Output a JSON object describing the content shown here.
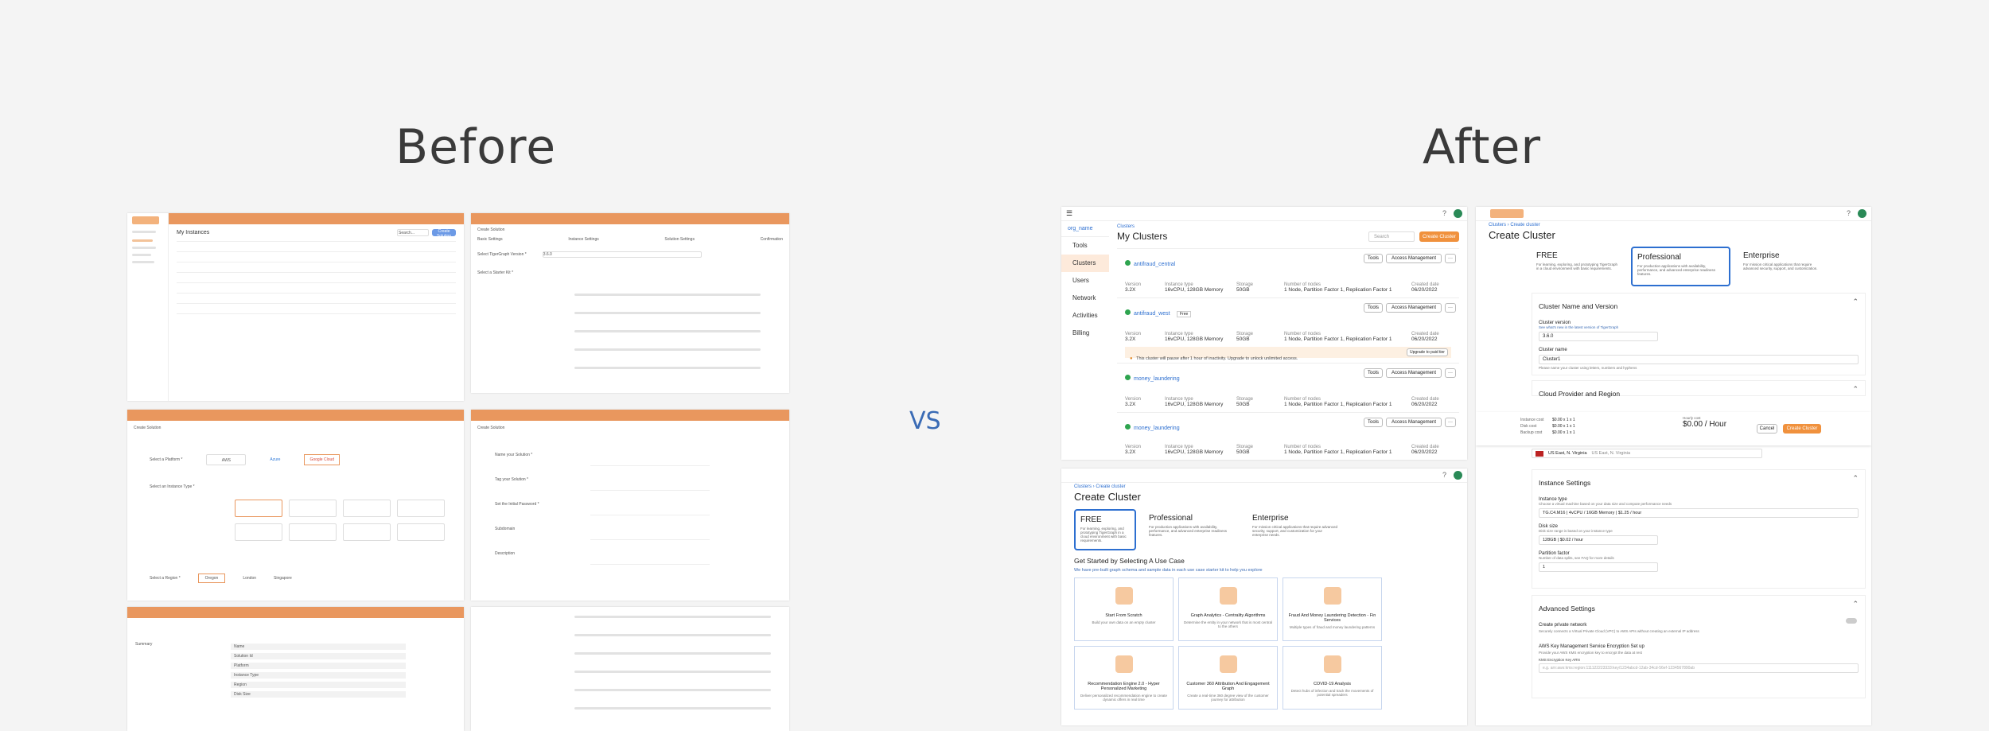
{
  "heading_before": "Before",
  "heading_after": "After",
  "vs_label": "VS",
  "brand": {
    "orange": "#e9975e",
    "accent": "#f0913d",
    "blue": "#2d6fd0",
    "vs_color": "#3a6bb5"
  },
  "before": {
    "shot1": {
      "title": "My Instances",
      "search_placeholder": "Search...",
      "new_btn": "Create Solution"
    },
    "shot2": {
      "title": "Create Solution",
      "steps": [
        "Basic Settings",
        "Instance Settings",
        "Solution Settings",
        "Confirmation"
      ],
      "version_label": "Select TigerGraph Version *",
      "version_value": "3.6.0",
      "starter_label": "Select a Starter Kit *"
    },
    "shot3": {
      "title": "Create Solution",
      "platform_label": "Select a Platform *",
      "platforms": [
        "AWS",
        "Azure",
        "Google Cloud"
      ],
      "instance_label": "Select an Instance Type *",
      "region_label": "Select a Region *",
      "regions": [
        "Oregon",
        "London",
        "Singapore"
      ]
    },
    "shot4": {
      "title": "Create Solution",
      "fields": [
        "Name your Solution *",
        "Tag your Solution *",
        "Set the Initial Password *",
        "Subdomain",
        "Description"
      ]
    },
    "shot5": {
      "title": "Summary",
      "rows": [
        "Name",
        "Solution Id",
        "Platform",
        "Instance Type",
        "Region",
        "Disk Size"
      ]
    }
  },
  "after": {
    "clusters": {
      "org_name": "org_name",
      "crumb": "Clusters",
      "title": "My Clusters",
      "search_placeholder": "Search",
      "create_btn": "Create Cluster",
      "nav": [
        "Tools",
        "Clusters",
        "Users",
        "Network",
        "Activities",
        "Billing"
      ],
      "tools_btn": "Tools",
      "access_btn": "Access Management",
      "col_headers": [
        "Version",
        "Instance type",
        "Storage",
        "Number of nodes",
        "Created date"
      ],
      "items": [
        {
          "name": "antifraud_central",
          "tag": "",
          "version": "3.2X",
          "instance": "16vCPU, 128GB Memory",
          "storage": "50GB",
          "nodes": "1 Node, Partition Factor 1, Replication Factor 1",
          "date": "06/20/2022"
        },
        {
          "name": "antifraud_west",
          "tag": "Free",
          "version": "3.2X",
          "instance": "16vCPU, 128GB Memory",
          "storage": "50GB",
          "nodes": "1 Node, Partition Factor 1, Replication Factor 1",
          "date": "06/20/2022"
        },
        {
          "name": "money_laundering",
          "tag": "",
          "version": "3.2X",
          "instance": "16vCPU, 128GB Memory",
          "storage": "50GB",
          "nodes": "1 Node, Partition Factor 1, Replication Factor 1",
          "date": "06/20/2022"
        },
        {
          "name": "money_laundering",
          "tag": "",
          "version": "3.2X",
          "instance": "16vCPU, 128GB Memory",
          "storage": "50GB",
          "nodes": "1 Node, Partition Factor 1, Replication Factor 1",
          "date": "06/20/2022"
        }
      ],
      "warning": "This cluster will pause after 1 hour of inactivity. Upgrade to unlock unlimited access.",
      "upgrade_btn": "Upgrade to paid tier"
    },
    "create": {
      "crumb": "Clusters  ›  Create cluster",
      "title": "Create Cluster",
      "tiers": [
        {
          "name": "FREE",
          "desc": "For learning, exploring, and prototyping TigerGraph in a cloud environment with basic requirements."
        },
        {
          "name": "Professional",
          "desc": "For production applications with availability, performance, and advanced enterprise readiness features."
        },
        {
          "name": "Enterprise",
          "desc": "For mission critical applications that require advanced security, support, and customization for your enterprise needs."
        }
      ],
      "usecase_title": "Get Started by Selecting A Use Case",
      "usecase_sub": "We have pre-built graph schema and sample data in each use case starter kit to help you explore",
      "cards": [
        {
          "title": "Start From Scratch",
          "sub": "Build your own data on an empty cluster"
        },
        {
          "title": "Graph Analytics - Centrality Algorithms",
          "sub": "Determine the entity in your network that is most central to the others"
        },
        {
          "title": "Fraud And Money Laundering Detection - Fin Services",
          "sub": "Multiple types of fraud and money laundering patterns"
        },
        {
          "title": "Recommendation Engine 2.0 - Hyper Personalized Marketing",
          "sub": "Deliver personalized recommendation engine to create dynamic offers in real time"
        },
        {
          "title": "Customer 360 Attribution And Engagement Graph",
          "sub": "Create a real-time 360 degree view of the customer journey for attribution"
        },
        {
          "title": "COVID-19 Analysis",
          "sub": "Detect hubs of infection and track the movements of potential spreaders"
        }
      ]
    },
    "form": {
      "crumb": "Clusters  ›  Create cluster",
      "title": "Create Cluster",
      "tiers": [
        "FREE",
        "Professional",
        "Enterprise"
      ],
      "tier_descs": [
        "For learning, exploring, and prototyping TigerGraph in a cloud environment with basic requirements.",
        "For production applications with availability, performance, and advanced enterprise readiness features.",
        "For mission critical applications that require advanced security, support, and customization."
      ],
      "sec_name": "Cluster Name and Version",
      "version_label": "Cluster version",
      "version_hint": "See what's new in the latest version of TigerGraph",
      "version_value": "3.6.0",
      "name_label": "Cluster name",
      "name_value": "Cluster1",
      "name_hint": "Please name your cluster using letters, numbers and hyphens",
      "sec_cloud": "Cloud Provider and Region",
      "cost_rows": [
        {
          "k": "Instance cost",
          "v": "$0.00 x 1 x 1"
        },
        {
          "k": "Disk cost",
          "v": "$0.00 x 1 x 1"
        },
        {
          "k": "Backup cost",
          "v": "$0.00 x 1 x 1"
        }
      ],
      "hourly_label": "Hourly cost",
      "hourly_value": "$0.00 / Hour",
      "cancel_btn": "Cancel",
      "create_btn": "Create Cluster",
      "region_value": "US East, N. Virginia",
      "region_sub": "US East, N. Virginia",
      "sec_instance": "Instance Settings",
      "itype_label": "Instance type",
      "itype_hint": "Choose a virtual machine based on your data size and compute performance needs",
      "itype_value": "TG.C4.M16 | 4vCPU / 16GB Memory | $1.25 / hour",
      "disk_label": "Disk size",
      "disk_hint": "Disk size range is based on your instance type",
      "disk_value": "128GB | $0.02 / hour",
      "part_label": "Partition factor",
      "part_hint": "Number of data splits, see FAQ for more details",
      "part_value": "1",
      "sec_adv": "Advanced Settings",
      "private_label": "Create private network",
      "private_hint": "Securely connects a Virtual Private Cloud (VPC) to AWS APIs without creating an external IP address",
      "kms_label": "AWS Key Management Service Encryption Set up",
      "kms_hint": "Provide your AWS KMS encryption key to encrypt the data at rest",
      "kms_field": "KMS Encryption Key ARN",
      "kms_placeholder": "e.g. arn:aws:kms:region:111122223333:key/1234abcd-12ab-34cd-56ef-1234567890ab"
    }
  }
}
